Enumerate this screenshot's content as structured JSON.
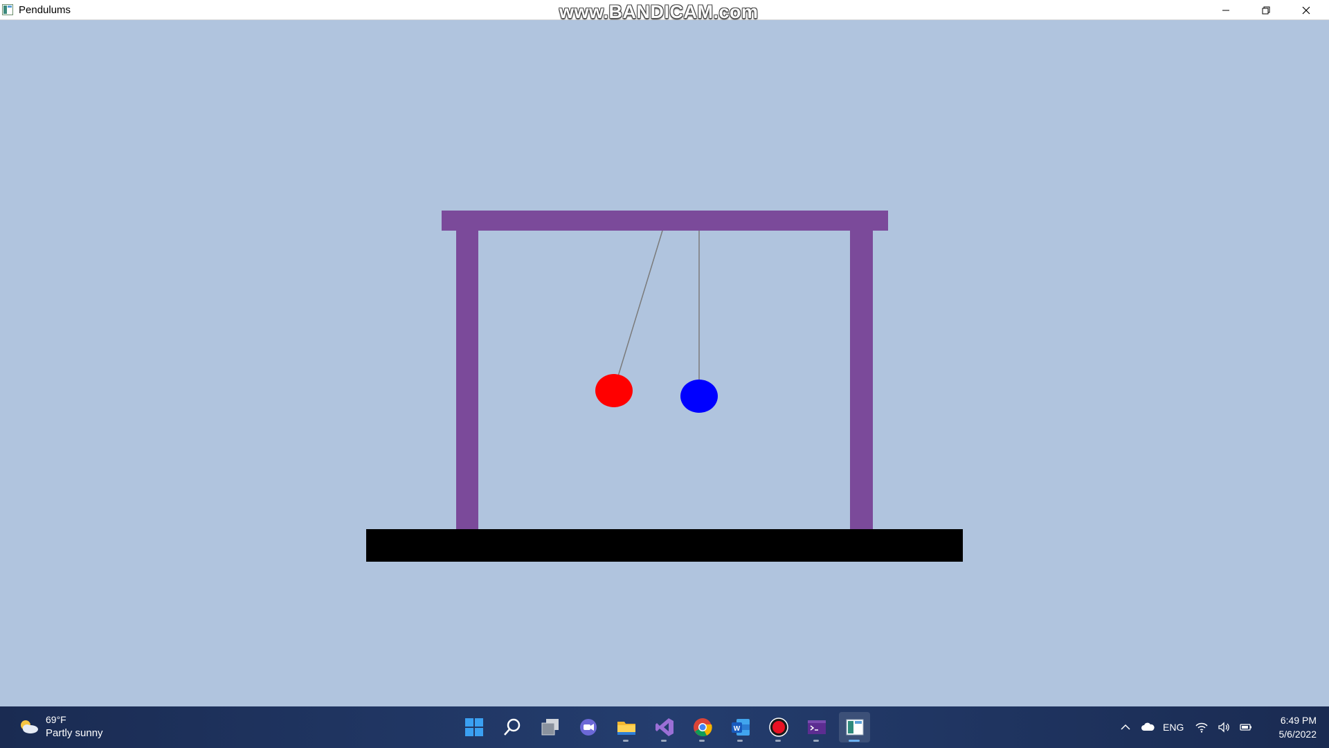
{
  "window": {
    "title": "Pendulums",
    "watermark": "www.BANDICAM.com",
    "controls": [
      "minimize",
      "restore",
      "close"
    ]
  },
  "scene": {
    "background_color": "#b0c4de",
    "frame_color": "#7b4a9a",
    "base_color": "#000000",
    "pendulums": [
      {
        "name": "red",
        "color": "#ff0000"
      },
      {
        "name": "blue",
        "color": "#0000ff"
      }
    ]
  },
  "taskbar": {
    "weather": {
      "temperature": "69°F",
      "condition": "Partly sunny",
      "icon": "partly-sunny-icon"
    },
    "apps": [
      {
        "name": "start",
        "icon": "windows-start-icon"
      },
      {
        "name": "search",
        "icon": "search-icon"
      },
      {
        "name": "task-view",
        "icon": "task-view-icon"
      },
      {
        "name": "chat",
        "icon": "teams-chat-icon"
      },
      {
        "name": "file-explorer",
        "icon": "folder-icon",
        "open": true
      },
      {
        "name": "visual-studio",
        "icon": "visual-studio-icon",
        "open": true
      },
      {
        "name": "chrome",
        "icon": "chrome-icon",
        "open": true
      },
      {
        "name": "word",
        "icon": "word-icon",
        "open": true
      },
      {
        "name": "bandicam",
        "icon": "record-icon",
        "open": true
      },
      {
        "name": "console",
        "icon": "terminal-icon",
        "open": true
      },
      {
        "name": "pendulums",
        "icon": "pendulums-app-icon",
        "open": true,
        "active": true
      }
    ],
    "tray": {
      "language": "ENG",
      "time": "6:49 PM",
      "date": "5/6/2022"
    }
  }
}
